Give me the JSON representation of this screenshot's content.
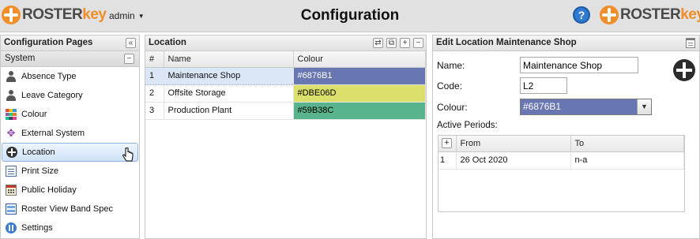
{
  "header": {
    "logo_text_a": "ROSTER",
    "logo_text_b": "key",
    "user": "admin",
    "title": "Configuration",
    "help_label": "?"
  },
  "left_panel": {
    "title": "Configuration Pages",
    "collapse_label": "«",
    "group": "System",
    "group_toggle": "−",
    "items": [
      {
        "label": "Absence Type",
        "icon": "person-icon"
      },
      {
        "label": "Leave Category",
        "icon": "person-icon"
      },
      {
        "label": "Colour",
        "icon": "palette-icon"
      },
      {
        "label": "External System",
        "icon": "external-icon"
      },
      {
        "label": "Location",
        "icon": "location-icon",
        "active": true
      },
      {
        "label": "Print Size",
        "icon": "document-icon"
      },
      {
        "label": "Public Holiday",
        "icon": "calendar-icon"
      },
      {
        "label": "Roster View Band Spec",
        "icon": "band-icon"
      },
      {
        "label": "Settings",
        "icon": "settings-icon"
      }
    ]
  },
  "mid_panel": {
    "title": "Location",
    "buttons": {
      "refresh": "⇄",
      "popout": "⧉",
      "add": "+",
      "remove": "−"
    },
    "columns": [
      "#",
      "Name",
      "Colour"
    ],
    "rows": [
      {
        "idx": "1",
        "name": "Maintenance Shop",
        "colour": "#6876B1",
        "text_color": "#ffffff"
      },
      {
        "idx": "2",
        "name": "Offsite Storage",
        "colour": "#DBE06D",
        "text_color": "#000000"
      },
      {
        "idx": "3",
        "name": "Production Plant",
        "colour": "#59B38C",
        "text_color": "#000000"
      }
    ]
  },
  "right_panel": {
    "title": "Edit Location Maintenance Shop",
    "name_label": "Name:",
    "name_value": "Maintenance Shop",
    "code_label": "Code:",
    "code_value": "L2",
    "colour_label": "Colour:",
    "colour_value": "#6876B1",
    "periods_label": "Active Periods:",
    "periods_add": "+",
    "periods_columns": [
      "From",
      "To"
    ],
    "periods": [
      {
        "idx": "1",
        "from": "26 Oct 2020",
        "to": "n-a"
      }
    ]
  }
}
